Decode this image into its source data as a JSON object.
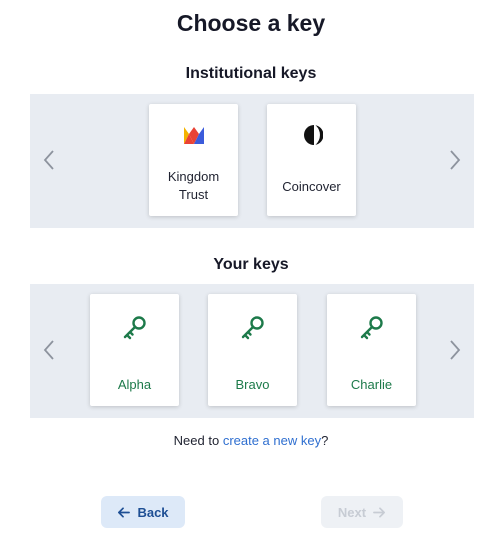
{
  "page": {
    "title": "Choose a key"
  },
  "institutional": {
    "title": "Institutional keys",
    "cards": [
      {
        "label": "Kingdom\nTrust",
        "icon": "kingdom-trust-logo"
      },
      {
        "label": "Coincover",
        "icon": "coincover-logo"
      }
    ]
  },
  "personal": {
    "title": "Your keys",
    "cards": [
      {
        "label": "Alpha",
        "icon": "key-icon"
      },
      {
        "label": "Bravo",
        "icon": "key-icon"
      },
      {
        "label": "Charlie",
        "icon": "key-icon"
      }
    ]
  },
  "helper": {
    "prefix": "Need to ",
    "link": "create a new key",
    "suffix": "?"
  },
  "actions": {
    "back_label": "Back",
    "next_label": "Next"
  },
  "colors": {
    "key_green": "#1d7a4a",
    "link_blue": "#2f6fd0",
    "band_bg": "#e8ecf2",
    "back_bg": "#dde9f8"
  }
}
